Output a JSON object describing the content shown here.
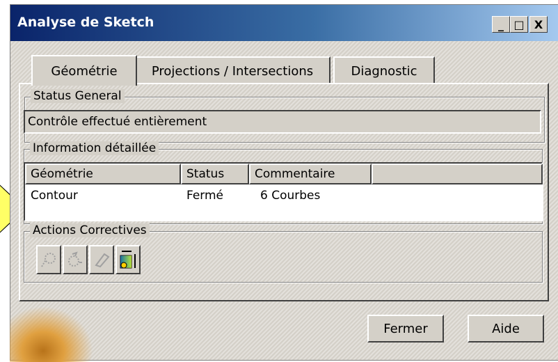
{
  "window": {
    "title": "Analyse de Sketch"
  },
  "titlebar_buttons": {
    "minimize": "_",
    "maximize": "□",
    "close": "X"
  },
  "tabs": [
    {
      "label": "Géométrie",
      "active": true
    },
    {
      "label": "Projections / Intersections",
      "active": false
    },
    {
      "label": "Diagnostic",
      "active": false
    }
  ],
  "status_general": {
    "label": "Status General",
    "value": "Contrôle effectué entièrement"
  },
  "details": {
    "label": "Information détaillée",
    "columns": [
      "Géométrie",
      "Status",
      "Commentaire",
      ""
    ],
    "rows": [
      {
        "geometrie": "Contour",
        "status": "Fermé",
        "commentaire": "6 Courbes"
      }
    ]
  },
  "actions": {
    "label": "Actions Correctives",
    "buttons": [
      {
        "icon": "trace-points-icon",
        "enabled": false
      },
      {
        "icon": "rotate-points-icon",
        "enabled": false
      },
      {
        "icon": "eraser-icon",
        "enabled": false
      },
      {
        "icon": "dimension-constraint-icon",
        "enabled": true
      }
    ]
  },
  "footer": {
    "close_label": "Fermer",
    "help_label": "Aide"
  },
  "colors": {
    "accent_title": "#0a246a",
    "arrow": "#ffff66"
  }
}
